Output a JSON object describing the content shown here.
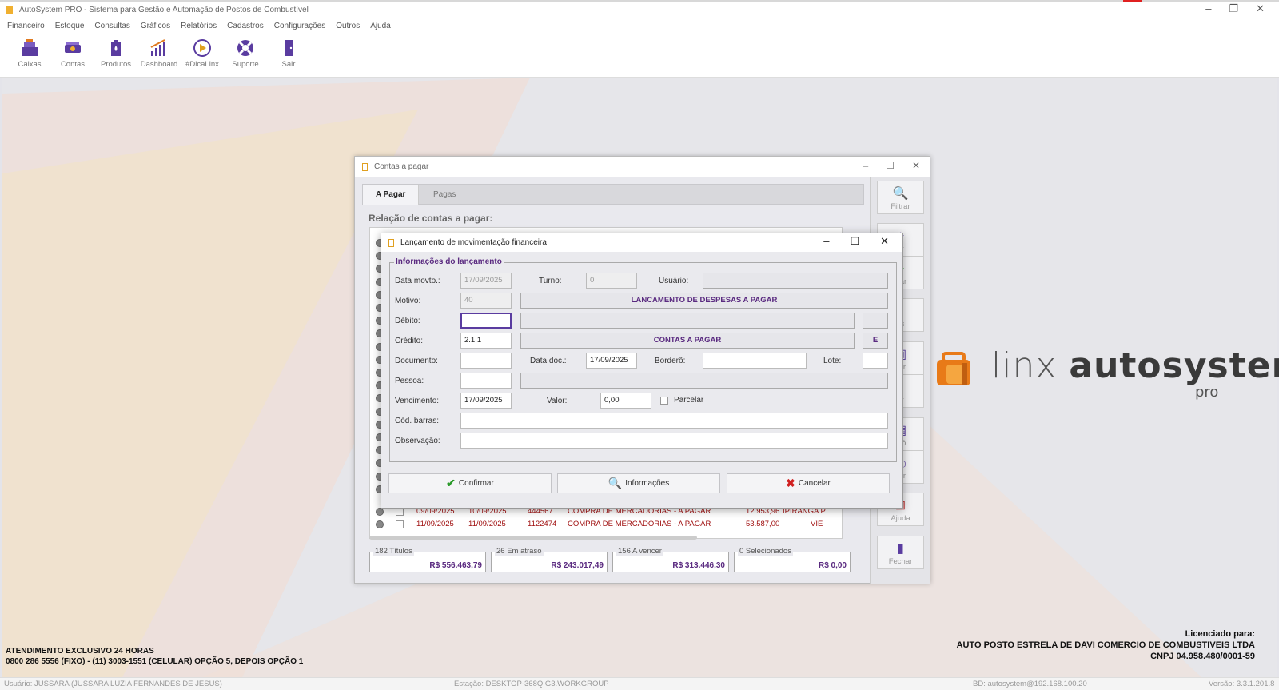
{
  "app": {
    "title": "AutoSystem PRO - Sistema para Gestão e Automação de Postos de Combustível",
    "menu": [
      "Financeiro",
      "Estoque",
      "Consultas",
      "Gráficos",
      "Relatórios",
      "Cadastros",
      "Configurações",
      "Outros",
      "Ajuda"
    ],
    "toolbar": [
      {
        "label": "Caixas",
        "icon": "cash-register-icon"
      },
      {
        "label": "Contas",
        "icon": "money-icon"
      },
      {
        "label": "Produtos",
        "icon": "fuel-product-icon"
      },
      {
        "label": "Dashboard",
        "icon": "bar-chart-icon"
      },
      {
        "label": "#DicaLinx",
        "icon": "play-icon"
      },
      {
        "label": "Suporte",
        "icon": "lifebuoy-icon"
      },
      {
        "label": "Sair",
        "icon": "exit-door-icon"
      }
    ]
  },
  "brand": {
    "text_light": "linx",
    "text_bold": "autosystem",
    "sub": "pro"
  },
  "support": {
    "line1": "ATENDIMENTO EXCLUSIVO 24 HORAS",
    "line2": "0800 286 5556 (FIXO) - (11) 3003-1551 (CELULAR) OPÇÃO 5, DEPOIS OPÇÃO 1"
  },
  "license": {
    "line1": "Licenciado para:",
    "line2": "AUTO POSTO ESTRELA DE DAVI COMERCIO DE COMBUSTIVEIS LTDA",
    "line3": "CNPJ 04.958.480/0001-59"
  },
  "statusbar": {
    "user": "Usuário: JUSSARA (JUSSARA LUZIA FERNANDES DE JESUS)",
    "station": "Estação: DESKTOP-368QIG3.WORKGROUP",
    "db": "BD: autosystem@192.168.100.20",
    "version": "Versão: 3.3.1.201.8"
  },
  "contas": {
    "title": "Contas a pagar",
    "tabs": [
      "A Pagar",
      "Pagas"
    ],
    "heading": "Relação de contas a pagar:",
    "rows": [
      {
        "venc": "09/09/2025",
        "doc_date": "10/09/2025",
        "doc": "444567",
        "desc": "COMPRA DE MERCADORIAS - A PAGAR",
        "valor": "12.953,96",
        "pessoa": "IPIRANGA P"
      },
      {
        "venc": "11/09/2025",
        "doc_date": "11/09/2025",
        "doc": "1122474",
        "desc": "COMPRA DE MERCADORIAS - A PAGAR",
        "valor": "53.587,00",
        "pessoa": "VIE"
      }
    ],
    "summary": [
      {
        "caption": "182 Títulos",
        "value": "R$ 556.463,79"
      },
      {
        "caption": "26 Em atraso",
        "value": "R$ 243.017,49"
      },
      {
        "caption": "156 A vencer",
        "value": "R$ 313.446,30"
      },
      {
        "caption": "0 Selecionados",
        "value": "R$ 0,00"
      }
    ],
    "side_buttons": [
      {
        "label": "Filtrar",
        "icon": "search-icon"
      },
      {
        "label": "ar",
        "icon": "add-icon"
      },
      {
        "label": "ciar",
        "icon": "plus-icon"
      },
      {
        "label": "as",
        "icon": "tag-icon"
      },
      {
        "label": "var",
        "icon": "save-icon"
      },
      {
        "label": "ar",
        "icon": "delete-icon"
      },
      {
        "label": "erô",
        "icon": "document-icon"
      },
      {
        "label": "mir",
        "icon": "print-icon"
      },
      {
        "label": "Ajuda",
        "icon": "help-icon"
      },
      {
        "label": "Fechar",
        "icon": "close-door-icon"
      }
    ]
  },
  "dialog": {
    "title": "Lançamento de movimentação financeira",
    "group_title": "Informações do lançamento",
    "labels": {
      "data_movto": "Data movto.:",
      "turno": "Turno:",
      "usuario": "Usuário:",
      "motivo": "Motivo:",
      "debito": "Débito:",
      "credito": "Crédito:",
      "documento": "Documento:",
      "data_doc": "Data doc.:",
      "bordero": "Borderô:",
      "lote": "Lote:",
      "pessoa": "Pessoa:",
      "vencimento": "Vencimento:",
      "valor": "Valor:",
      "parcelar": "Parcelar",
      "cod_barras": "Cód. barras:",
      "observacao": "Observação:"
    },
    "values": {
      "data_movto": "17/09/2025",
      "turno": "0",
      "usuario": "",
      "motivo": "40",
      "motivo_desc": "LANCAMENTO DE DESPESAS A PAGAR",
      "debito": "",
      "debito_desc": "",
      "debito_extra": "",
      "credito": "2.1.1",
      "credito_desc": "CONTAS A PAGAR",
      "credito_extra": "E",
      "documento": "",
      "data_doc": "17/09/2025",
      "bordero": "",
      "lote": "",
      "pessoa": "",
      "pessoa_desc": "",
      "vencimento": "17/09/2025",
      "valor": "0,00",
      "cod_barras": "",
      "observacao": ""
    },
    "buttons": {
      "confirm": "Confirmar",
      "info": "Informações",
      "cancel": "Cancelar"
    }
  }
}
